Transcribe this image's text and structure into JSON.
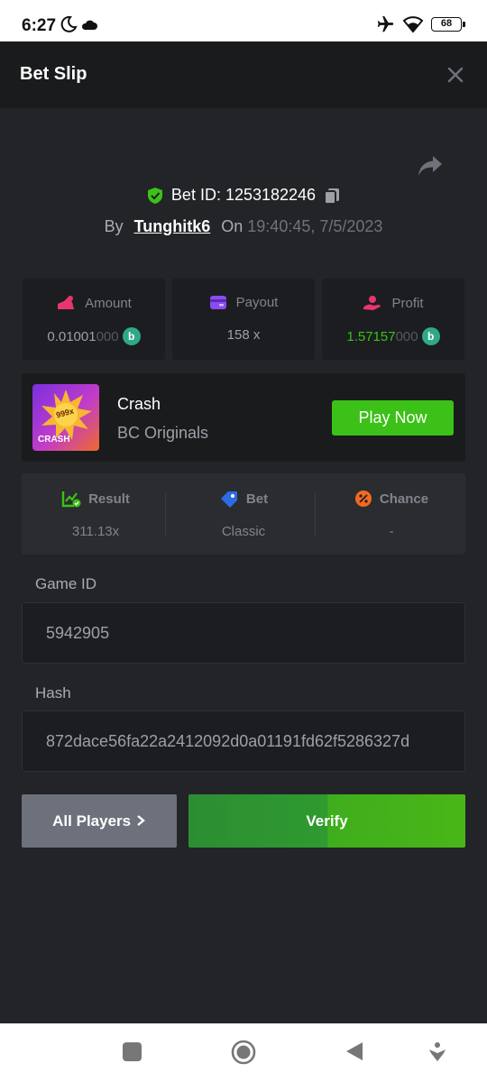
{
  "status_bar": {
    "time": "6:27",
    "battery": "68"
  },
  "header": {
    "title": "Bet Slip"
  },
  "bet": {
    "id_label": "Bet ID: 1253182246",
    "by_label": "By",
    "user": "Tunghitk6",
    "on_label": "On",
    "datetime": "19:40:45, 7/5/2023"
  },
  "stats": {
    "amount": {
      "label": "Amount",
      "value_main": "0.01001",
      "value_dim": "000"
    },
    "payout": {
      "label": "Payout",
      "value": "158 x"
    },
    "profit": {
      "label": "Profit",
      "value_main": "1.57157",
      "value_dim": "000"
    }
  },
  "game": {
    "thumb_badge": "999x",
    "thumb_label": "CRASH",
    "name": "Crash",
    "provider": "BC Originals",
    "play_label": "Play Now"
  },
  "result": {
    "result_label": "Result",
    "result_value": "311.13x",
    "bet_label": "Bet",
    "bet_value": "Classic",
    "chance_label": "Chance",
    "chance_value": "-"
  },
  "game_id": {
    "label": "Game ID",
    "value": "5942905"
  },
  "hash": {
    "label": "Hash",
    "value": "872dace56fa22a2412092d0a01191fd62f5286327d"
  },
  "actions": {
    "all_players": "All Players",
    "verify": "Verify"
  },
  "colors": {
    "background": "#232427",
    "header": "#1a1b1d",
    "accent_green": "#3bc117",
    "coin": "#2fa88a",
    "all_players_button": "#6d717b"
  }
}
